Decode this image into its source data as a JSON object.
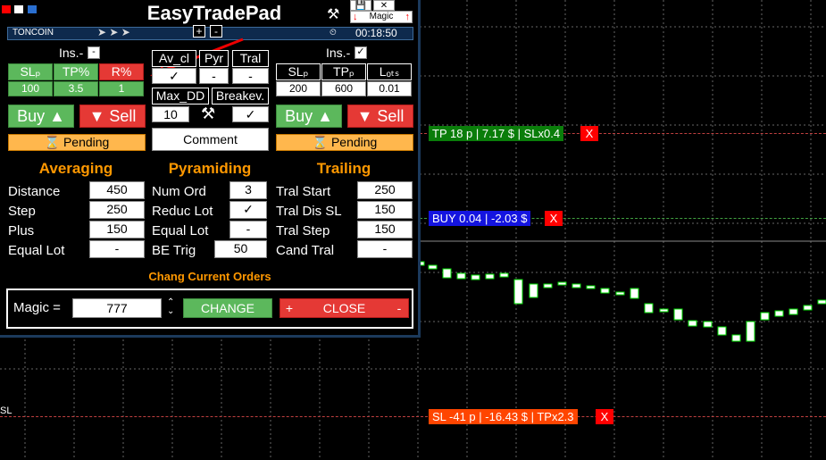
{
  "header": {
    "title": "EasyTradePad",
    "magic_label": "Magic"
  },
  "toolbar": {
    "symbol": "TONCOIN",
    "time": "00:18:50",
    "plus": "+",
    "minus": "-"
  },
  "left_block": {
    "ins_label": "Ins.-",
    "ins_box": "-",
    "headers": [
      "SLₚ",
      "TP%",
      "R%"
    ],
    "values": [
      "100",
      "3.5",
      "1"
    ]
  },
  "middle_block": {
    "headers": [
      "Av_cl",
      "Pyr",
      "Tral"
    ],
    "values": [
      "✓",
      "-",
      "-"
    ],
    "max_dd_label": "Max_DD",
    "breakeven_label": "Breakev.",
    "max_dd_value": "10",
    "breakeven_value": "✓",
    "comment_label": "Comment"
  },
  "right_block": {
    "ins_label": "Ins.-",
    "ins_box": "✓",
    "headers": [
      "SLₚ",
      "TPₚ",
      "Lₒₜₛ"
    ],
    "values": [
      "200",
      "600",
      "0.01"
    ]
  },
  "buttons": {
    "buy": "Buy",
    "sell": "Sell",
    "pending": "Pending"
  },
  "sections": {
    "averaging": "Averaging",
    "pyramiding": "Pyramiding",
    "trailing": "Trailing",
    "change_orders": "Chang Current Orders"
  },
  "averaging": [
    {
      "label": "Distance",
      "value": "450"
    },
    {
      "label": "Step",
      "value": "250"
    },
    {
      "label": "Plus",
      "value": "150"
    },
    {
      "label": "Equal Lot",
      "value": "-"
    }
  ],
  "pyramiding": [
    {
      "label": "Num Ord",
      "value": "3"
    },
    {
      "label": "Reduc Lot",
      "value": "✓"
    },
    {
      "label": "Equal Lot",
      "value": "-"
    },
    {
      "label": "BE Trig",
      "value": "50"
    }
  ],
  "trailing": [
    {
      "label": "Tral Start",
      "value": "250"
    },
    {
      "label": "Tral Dis SL",
      "value": "150"
    },
    {
      "label": "Tral Step",
      "value": "150"
    },
    {
      "label": "Cand Tral",
      "value": "-"
    }
  ],
  "change": {
    "magic_label": "Magic =",
    "magic_value": "777",
    "change_btn": "CHANGE",
    "close_btn": "CLOSE",
    "plus": "+",
    "minus": "-"
  },
  "chart_lines": {
    "tp": "TP 18 p | 7.17 $ | SLx0.4",
    "buy": "BUY 0.04 | -2.03 $",
    "sl": "SL -41 p | -16.43 $ | TPx2.3",
    "sl_axis": "SL",
    "close_x": "X"
  },
  "colors": {
    "tp": "#0a7d0a",
    "buy": "#1414e0",
    "sl": "#ff4500",
    "accent": "#ff9800"
  }
}
